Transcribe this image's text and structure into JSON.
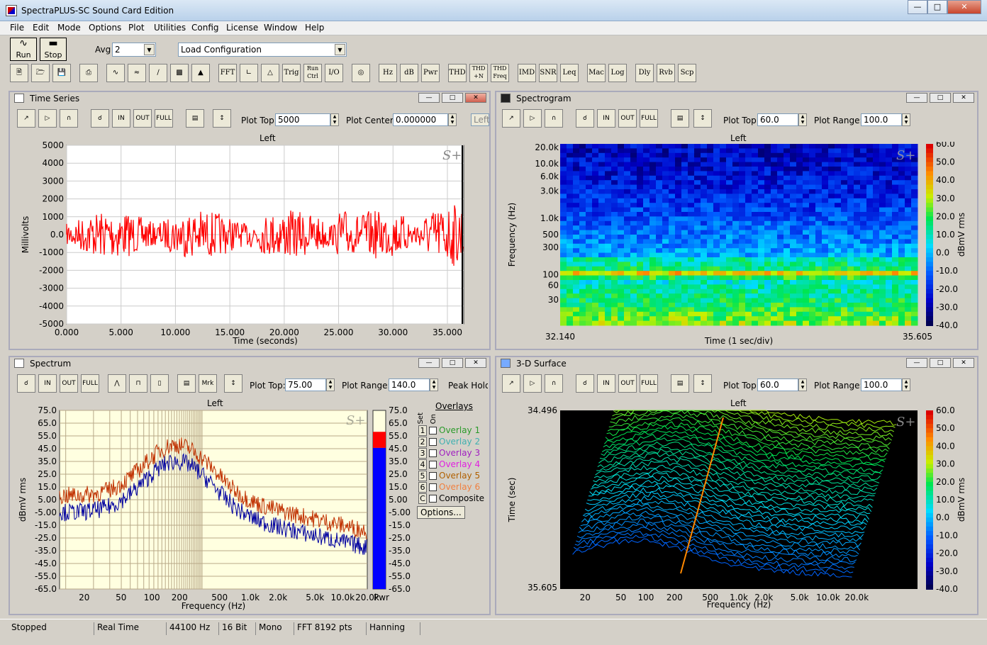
{
  "window": {
    "title": "SpectraPLUS-SC Sound Card Edition"
  },
  "menu": [
    "File",
    "Edit",
    "Mode",
    "Options",
    "Plot",
    "Utilities",
    "Config",
    "License",
    "Window",
    "Help"
  ],
  "controls": {
    "run": "Run",
    "stop": "Stop",
    "avg_label": "Avg",
    "avg_value": "2",
    "load_config": "Load Configuration"
  },
  "toolbar": [
    "FFT",
    "Trig",
    "Run Ctrl",
    "I/O",
    "Hz",
    "dB",
    "Pwr",
    "THD",
    "THD +N",
    "THD Freq",
    "IMD",
    "SNR",
    "Leq",
    "Mac",
    "Log",
    "Dly",
    "Rvb",
    "Scp"
  ],
  "time_series": {
    "title": "Time Series",
    "plot_top_label": "Plot Top",
    "plot_top": "5000",
    "plot_center_label": "Plot Center",
    "plot_center": "0.000000",
    "left_btn": "Left",
    "channel": "Left",
    "yticks": [
      "5000",
      "4000",
      "3000",
      "2000",
      "1000",
      "0.0",
      "-1000",
      "-2000",
      "-3000",
      "-4000",
      "-5000"
    ],
    "xticks": [
      "0.000",
      "5.000",
      "10.000",
      "15.000",
      "20.000",
      "25.000",
      "30.000",
      "35.000"
    ],
    "ylabel": "Millivolts",
    "xlabel": "Time (seconds)",
    "logo": "S+"
  },
  "spectrogram": {
    "title": "Spectrogram",
    "plot_top_label": "Plot Top",
    "plot_top": "60.0",
    "plot_range_label": "Plot Range:",
    "plot_range": "100.0",
    "channel": "Left",
    "yticks": [
      "20.0k",
      "10.0k",
      "6.0k",
      "3.0k",
      "1.0k",
      "500",
      "300",
      "100",
      "60",
      "30"
    ],
    "x_start": "32.140",
    "x_end": "35.605",
    "xlabel": "Time (1 sec/div)",
    "ylabel": "Frequency (Hz)",
    "cbar_ticks": [
      "60.0",
      "50.0",
      "40.0",
      "30.0",
      "20.0",
      "10.0",
      "0.0",
      "-10.0",
      "-20.0",
      "-30.0",
      "-40.0"
    ],
    "cbar_label": "dBmV rms",
    "logo": "S+"
  },
  "spectrum": {
    "title": "Spectrum",
    "plot_top_label": "Plot Top:",
    "plot_top": "75.00",
    "plot_range_label": "Plot Range:",
    "plot_range": "140.0",
    "peak_hold": "Peak Hold",
    "mrk": "Mrk",
    "channel": "Left",
    "yticks": [
      "75.0",
      "65.0",
      "55.0",
      "45.0",
      "35.0",
      "25.0",
      "15.0",
      "5.00",
      "-5.00",
      "-15.0",
      "-25.0",
      "-35.0",
      "-45.0",
      "-55.0",
      "-65.0"
    ],
    "xticks": [
      "20",
      "50",
      "100",
      "200",
      "500",
      "1.0k",
      "2.0k",
      "5.0k",
      "10.0k",
      "20.0k"
    ],
    "ylabel": "dBmV rms",
    "xlabel": "Frequency (Hz)",
    "pwr_label": "Pwr",
    "logo": "S+",
    "meter_ticks": [
      "75.0",
      "65.0",
      "55.0",
      "45.0",
      "35.0",
      "25.0",
      "15.0",
      "5.00",
      "-5.00",
      "-15.0",
      "-25.0",
      "-35.0",
      "-45.0",
      "-55.0",
      "-65.0"
    ],
    "overlays_title": "Overlays",
    "set_label": "Set",
    "on_label": "On",
    "overlays": [
      {
        "num": "1",
        "name": "Overlay 1",
        "color": "#2a9a2a"
      },
      {
        "num": "2",
        "name": "Overlay 2",
        "color": "#40b0b0"
      },
      {
        "num": "3",
        "name": "Overlay 3",
        "color": "#a020c0"
      },
      {
        "num": "4",
        "name": "Overlay 4",
        "color": "#e020e0"
      },
      {
        "num": "5",
        "name": "Overlay 5",
        "color": "#b06000"
      },
      {
        "num": "6",
        "name": "Overlay 6",
        "color": "#f08040"
      },
      {
        "num": "C",
        "name": "Composite",
        "color": "#000000"
      }
    ],
    "options_btn": "Options..."
  },
  "surface": {
    "title": "3-D Surface",
    "plot_top_label": "Plot Top",
    "plot_top": "60.0",
    "plot_range_label": "Plot Range:",
    "plot_range": "100.0",
    "channel": "Left",
    "y_top": "34.496",
    "y_bottom": "35.605",
    "ylabel": "Time (sec)",
    "xticks": [
      "20",
      "50",
      "100",
      "200",
      "500",
      "1.0k",
      "2.0k",
      "5.0k",
      "10.0k",
      "20.0k"
    ],
    "xlabel": "Frequency (Hz)",
    "cbar_ticks": [
      "60.0",
      "50.0",
      "40.0",
      "30.0",
      "20.0",
      "10.0",
      "0.0",
      "-10.0",
      "-20.0",
      "-30.0",
      "-40.0"
    ],
    "cbar_label": "dBmV rms",
    "logo": "S+"
  },
  "status": [
    "Stopped",
    "Real Time",
    "44100 Hz",
    "16 Bit",
    "Mono",
    "FFT 8192 pts",
    "Hanning"
  ]
}
